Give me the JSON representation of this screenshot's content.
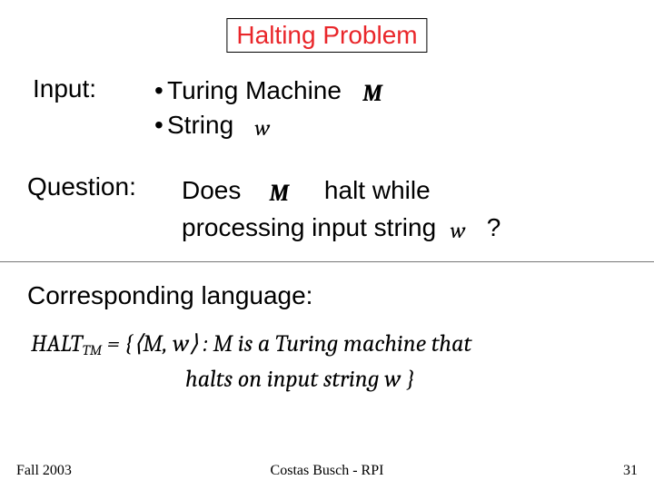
{
  "title": "Halting Problem",
  "input": {
    "label": "Input:",
    "bullet1_prefix": "•",
    "bullet1_text": "Turing Machine",
    "bullet1_var": "M",
    "bullet2_prefix": "•",
    "bullet2_text": "String",
    "bullet2_var": "w"
  },
  "question": {
    "label": "Question:",
    "does": "Does",
    "var_M": "M",
    "halt_while": "halt while",
    "processing": "processing input string",
    "var_w": "w",
    "qmark": "?"
  },
  "corresponding": "Corresponding language:",
  "formula": {
    "lhs_name": "HALT",
    "lhs_sub": "TM",
    "eq": " = {",
    "pair_open": "⟨",
    "pair_M": "M",
    "pair_comma": ", ",
    "pair_w": "w",
    "pair_close": "⟩",
    "colon": " : ",
    "line1_tail": "M is a Turing machine that",
    "line2": "halts on input string w }"
  },
  "footer": {
    "left": "Fall 2003",
    "center": "Costas Busch - RPI",
    "right": "31"
  }
}
